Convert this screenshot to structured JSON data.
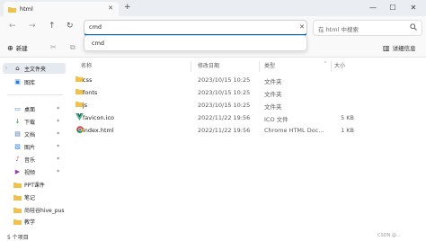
{
  "tab": {
    "title": "html",
    "close": "✕",
    "icon": "folder-icon"
  },
  "new_tab": "+",
  "window_controls": {
    "minimize": "—",
    "maximize": "☐",
    "close": "✕"
  },
  "nav": {
    "back": "←",
    "forward": "→",
    "up": "↑",
    "refresh": "↻"
  },
  "address": {
    "value": "cmd",
    "clear": "✕"
  },
  "suggestion": "cmd",
  "search": {
    "placeholder": "在 html 中搜索",
    "icon": "search-icon"
  },
  "toolbar": {
    "new_label": "新建",
    "new_icon": "⊕",
    "details_label": "详细信息",
    "details_icon": "▥"
  },
  "columns": {
    "name": "名称",
    "date": "修改日期",
    "type": "类型",
    "size": "大小"
  },
  "files": [
    {
      "icon": "folder-icon",
      "name": "css",
      "date": "2023/10/15 10:25",
      "type": "文件夹",
      "size": ""
    },
    {
      "icon": "folder-icon",
      "name": "fonts",
      "date": "2023/10/15 10:25",
      "type": "文件夹",
      "size": ""
    },
    {
      "icon": "folder-icon",
      "name": "js",
      "date": "2023/10/15 10:25",
      "type": "文件夹",
      "size": ""
    },
    {
      "icon": "vue-icon",
      "name": "favicon.ico",
      "date": "2022/11/22 19:56",
      "type": "ICO 文件",
      "size": "5 KB"
    },
    {
      "icon": "chrome-icon",
      "name": "index.html",
      "date": "2022/11/22 19:56",
      "type": "Chrome HTML Doc...",
      "size": "1 KB"
    }
  ],
  "sidebar": {
    "groups_top": [
      {
        "label": "主文件夹",
        "icon": "home-icon"
      },
      {
        "label": "图库",
        "icon": "gallery-icon"
      }
    ],
    "pinned": [
      {
        "label": "桌面",
        "icon": "desktop-icon"
      },
      {
        "label": "下载",
        "icon": "download-icon"
      },
      {
        "label": "文档",
        "icon": "document-icon"
      },
      {
        "label": "图片",
        "icon": "pictures-icon"
      },
      {
        "label": "音乐",
        "icon": "music-icon"
      },
      {
        "label": "视频",
        "icon": "video-icon"
      },
      {
        "label": "PPT课件",
        "icon": "folder-icon"
      },
      {
        "label": "笔记",
        "icon": "folder-icon"
      },
      {
        "label": "尚硅谷hive_pus",
        "icon": "folder-icon"
      },
      {
        "label": "教学",
        "icon": "folder-icon"
      }
    ]
  },
  "status": {
    "count": "5 个项目",
    "watermark": "CSDN @..."
  },
  "colors": {
    "accent": "#0067c0",
    "folder": "#f0c14b",
    "sidebar_active": "#e5eaf1"
  }
}
